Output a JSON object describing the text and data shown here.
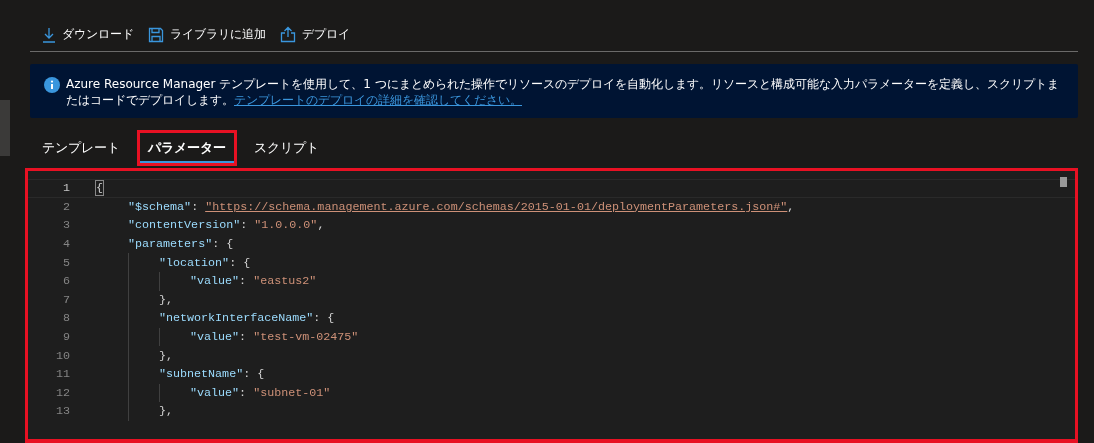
{
  "toolbar": [
    {
      "kind": "download",
      "label": "ダウンロード"
    },
    {
      "kind": "save",
      "label": "ライブラリに追加"
    },
    {
      "kind": "upload",
      "label": "デプロイ"
    }
  ],
  "info_banner": {
    "text": "Azure Resource Manager テンプレートを使用して、1 つにまとめられた操作でリソースのデプロイを自動化します。リソースと構成可能な入力パラメーターを定義し、スクリプトまたはコードでデプロイします。",
    "link": "テンプレートのデプロイの詳細を確認してください。"
  },
  "tabs": [
    {
      "label": "テンプレート",
      "selected": false
    },
    {
      "label": "パラメーター",
      "selected": true
    },
    {
      "label": "スクリプト",
      "selected": false
    }
  ],
  "editor": {
    "lines": [
      {
        "number": "1",
        "current": true,
        "tokens": [
          {
            "kind": "punct",
            "text": "{"
          }
        ],
        "children": [
          {
            "number": "2",
            "tokens": [
              {
                "kind": "key",
                "text": "\"$schema\""
              },
              {
                "kind": "punct",
                "text": ": "
              },
              {
                "kind": "link",
                "text": "\"https://schema.management.azure.com/schemas/2015-01-01/deploymentParameters.json#\""
              },
              {
                "kind": "punct",
                "text": ","
              }
            ]
          },
          {
            "number": "3",
            "tokens": [
              {
                "kind": "key",
                "text": "\"contentVersion\""
              },
              {
                "kind": "punct",
                "text": ": "
              },
              {
                "kind": "string",
                "text": "\"1.0.0.0\""
              },
              {
                "kind": "punct",
                "text": ","
              }
            ]
          },
          {
            "number": "4",
            "tokens": [
              {
                "kind": "key",
                "text": "\"parameters\""
              },
              {
                "kind": "punct",
                "text": ": {"
              }
            ],
            "children": [
              {
                "number": "5",
                "tokens": [
                  {
                    "kind": "key",
                    "text": "\"location\""
                  },
                  {
                    "kind": "punct",
                    "text": ": {"
                  }
                ],
                "children": [
                  {
                    "number": "6",
                    "tokens": [
                      {
                        "kind": "key",
                        "text": "\"value\""
                      },
                      {
                        "kind": "punct",
                        "text": ": "
                      },
                      {
                        "kind": "string",
                        "text": "\"eastus2\""
                      }
                    ]
                  }
                ]
              },
              {
                "number": "7",
                "tokens": [
                  {
                    "kind": "punct",
                    "text": "},"
                  }
                ]
              },
              {
                "number": "8",
                "tokens": [
                  {
                    "kind": "key",
                    "text": "\"networkInterfaceName\""
                  },
                  {
                    "kind": "punct",
                    "text": ": {"
                  }
                ],
                "children": [
                  {
                    "number": "9",
                    "tokens": [
                      {
                        "kind": "key",
                        "text": "\"value\""
                      },
                      {
                        "kind": "punct",
                        "text": ": "
                      },
                      {
                        "kind": "string",
                        "text": "\"test-vm-02475\""
                      }
                    ]
                  }
                ]
              },
              {
                "number": "10",
                "tokens": [
                  {
                    "kind": "punct",
                    "text": "},"
                  }
                ]
              },
              {
                "number": "11",
                "tokens": [
                  {
                    "kind": "key",
                    "text": "\"subnetName\""
                  },
                  {
                    "kind": "punct",
                    "text": ": {"
                  }
                ],
                "children": [
                  {
                    "number": "12",
                    "tokens": [
                      {
                        "kind": "key",
                        "text": "\"value\""
                      },
                      {
                        "kind": "punct",
                        "text": ": "
                      },
                      {
                        "kind": "string",
                        "text": "\"subnet-01\""
                      }
                    ]
                  }
                ]
              },
              {
                "number": "13",
                "tokens": [
                  {
                    "kind": "punct",
                    "text": "},"
                  }
                ]
              }
            ]
          }
        ]
      }
    ]
  }
}
